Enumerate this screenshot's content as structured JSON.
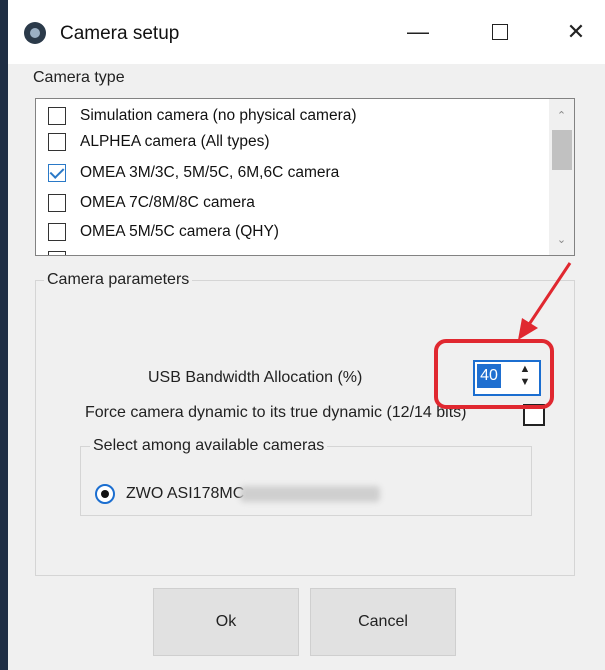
{
  "window": {
    "title": "Camera setup",
    "controls": {
      "minimize": "—",
      "close": "✕"
    }
  },
  "camera_type": {
    "label": "Camera type",
    "items": [
      {
        "label": "Simulation camera (no physical camera)",
        "checked": false
      },
      {
        "label": "ALPHEA camera (All types)",
        "checked": false
      },
      {
        "label": "OMEA 3M/3C, 5M/5C, 6M,6C camera",
        "checked": true
      },
      {
        "label": "OMEA 7C/8M/8C camera",
        "checked": false
      },
      {
        "label": "OMEA 5M/5C camera (QHY)",
        "checked": false
      }
    ]
  },
  "params": {
    "group_label": "Camera parameters",
    "usb_label": "USB Bandwidth Allocation (%)",
    "usb_value": "40",
    "force_label": "Force camera dynamic to its true dynamic (12/14 bits)",
    "force_checked": false,
    "select_group_label": "Select among available cameras",
    "camera_option": "ZWO ASI178MC",
    "camera_selected": true
  },
  "buttons": {
    "ok": "Ok",
    "cancel": "Cancel"
  },
  "colors": {
    "annotation": "#e02830",
    "accent": "#1f6fd0",
    "checkbox_check": "#2a79c7"
  },
  "icons": {
    "spin_up": "▲",
    "spin_down": "▼",
    "scroll_up": "⌃",
    "scroll_down": "⌄"
  }
}
